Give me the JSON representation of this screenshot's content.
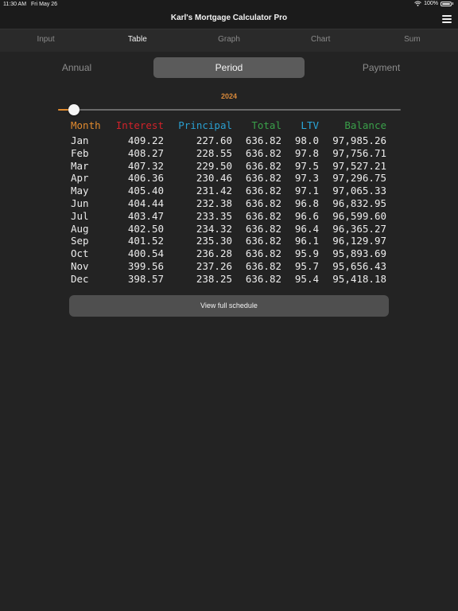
{
  "status": {
    "time": "11:30 AM",
    "date": "Fri May 26",
    "battery": "100%"
  },
  "app": {
    "title": "Karl's Mortgage Calculator Pro"
  },
  "tabs": [
    {
      "label": "Input",
      "active": false
    },
    {
      "label": "Table",
      "active": true
    },
    {
      "label": "Graph",
      "active": false
    },
    {
      "label": "Chart",
      "active": false
    },
    {
      "label": "Sum",
      "active": false
    }
  ],
  "segments": [
    {
      "label": "Annual",
      "active": false
    },
    {
      "label": "Period",
      "active": true
    },
    {
      "label": "Payment",
      "active": false
    }
  ],
  "year": "2024",
  "slider": {
    "value_fraction": 0.02
  },
  "table": {
    "headers": {
      "month": "Month",
      "interest": "Interest",
      "principal": "Principal",
      "total": "Total",
      "ltv": "LTV",
      "balance": "Balance"
    },
    "rows": [
      {
        "month": "Jan",
        "interest": "409.22",
        "principal": "227.60",
        "total": "636.82",
        "ltv": "98.0",
        "balance": "97,985.26"
      },
      {
        "month": "Feb",
        "interest": "408.27",
        "principal": "228.55",
        "total": "636.82",
        "ltv": "97.8",
        "balance": "97,756.71"
      },
      {
        "month": "Mar",
        "interest": "407.32",
        "principal": "229.50",
        "total": "636.82",
        "ltv": "97.5",
        "balance": "97,527.21"
      },
      {
        "month": "Apr",
        "interest": "406.36",
        "principal": "230.46",
        "total": "636.82",
        "ltv": "97.3",
        "balance": "97,296.75"
      },
      {
        "month": "May",
        "interest": "405.40",
        "principal": "231.42",
        "total": "636.82",
        "ltv": "97.1",
        "balance": "97,065.33"
      },
      {
        "month": "Jun",
        "interest": "404.44",
        "principal": "232.38",
        "total": "636.82",
        "ltv": "96.8",
        "balance": "96,832.95"
      },
      {
        "month": "Jul",
        "interest": "403.47",
        "principal": "233.35",
        "total": "636.82",
        "ltv": "96.6",
        "balance": "96,599.60"
      },
      {
        "month": "Aug",
        "interest": "402.50",
        "principal": "234.32",
        "total": "636.82",
        "ltv": "96.4",
        "balance": "96,365.27"
      },
      {
        "month": "Sep",
        "interest": "401.52",
        "principal": "235.30",
        "total": "636.82",
        "ltv": "96.1",
        "balance": "96,129.97"
      },
      {
        "month": "Oct",
        "interest": "400.54",
        "principal": "236.28",
        "total": "636.82",
        "ltv": "95.9",
        "balance": "95,893.69"
      },
      {
        "month": "Nov",
        "interest": "399.56",
        "principal": "237.26",
        "total": "636.82",
        "ltv": "95.7",
        "balance": "95,656.43"
      },
      {
        "month": "Dec",
        "interest": "398.57",
        "principal": "238.25",
        "total": "636.82",
        "ltv": "95.4",
        "balance": "95,418.18"
      }
    ]
  },
  "buttons": {
    "full_schedule": "View full schedule"
  },
  "icons": {
    "menu": "hamburger-menu-icon",
    "wifi": "wifi-icon",
    "battery": "battery-icon"
  },
  "colors": {
    "month": "#e08a2e",
    "interest": "#d2222a",
    "principal": "#2a9fd0",
    "total": "#3aa04a",
    "ltv": "#2aa8dc",
    "balance": "#3aa04a",
    "year": "#d9893a"
  }
}
